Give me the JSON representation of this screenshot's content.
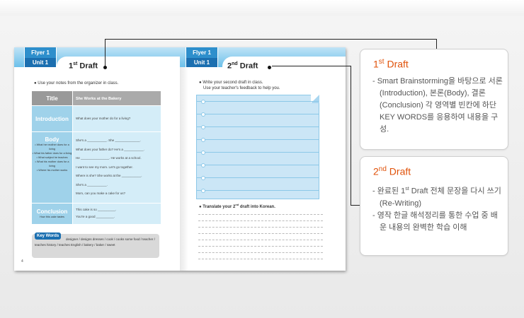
{
  "book": {
    "left_page": {
      "tab_flyer": "Flyer 1",
      "tab_unit": "Unit 1",
      "title_num": "1",
      "title_sup": "st",
      "title_rest": " Draft",
      "instruction": "Use your notes from the organizer in class.",
      "table": {
        "header": {
          "label": "Title",
          "value": "She Works at the Bakery"
        },
        "intro": {
          "label": "Introduction",
          "text": "What does your mother do for a living?"
        },
        "body": {
          "label": "Body",
          "notes": [
            "• What her mother does for a living",
            "• What his father does for a living",
            "• What subject he teaches",
            "• What his mother does for a living",
            "• Where his mother works"
          ],
          "lines": [
            "She's a ___________. She ______________.",
            "What does your father do? He's a ___________.",
            "He ________________. He works at a school.",
            "I want to see my mom. Let's go together.",
            "Where is she? She works at the ___________.",
            "She's a ___________.",
            "Mom, can you make a cake for us?"
          ]
        },
        "conclusion": {
          "label": "Conclusion",
          "note": "How this cake tastes",
          "lines": [
            "This cake is so __________.",
            "You're a good __________."
          ]
        }
      },
      "key_words_label": "Key Words",
      "key_words": "designer / designs dresses / cook / cooks some food / teacher / teaches history / teaches English / bakery / baker / sweet",
      "page_number": "4"
    },
    "right_page": {
      "tab_flyer": "Flyer 1",
      "tab_unit": "Unit 1",
      "title_num": "2",
      "title_sup": "nd",
      "title_rest": " Draft",
      "instruction_1": "Write your second draft in class.",
      "instruction_2": "Use your teacher's feedback to help you.",
      "translate_pre": "Translate your 2",
      "translate_sup": "nd",
      "translate_post": " draft into Korean."
    }
  },
  "cards": [
    {
      "title_num": "1",
      "title_sup": "st",
      "title_rest": " Draft",
      "items": [
        "- Smart Brainstorming을 바탕으로 서론(Introduction), 본론(Body), 결론(Conclusion) 각 영역별 빈칸에 하단 KEY WORDS를 응용하여 내용을 구성."
      ]
    },
    {
      "title_num": "2",
      "title_sup": "nd",
      "title_rest": " Draft",
      "item1_pre": "- 완료된 1",
      "item1_sup": "st",
      "item1_post": " Draft 전체 문장을 다시 쓰기(Re-Writing)",
      "item2": "- 영작 한글 해석정리를 통한 수업 중 배운 내용의 완벽한 학습 이해"
    }
  ],
  "colors": {
    "accent_orange": "#e0520a",
    "tab_blue": "#1b6fb0",
    "table_blue": "#9fd2ea"
  }
}
